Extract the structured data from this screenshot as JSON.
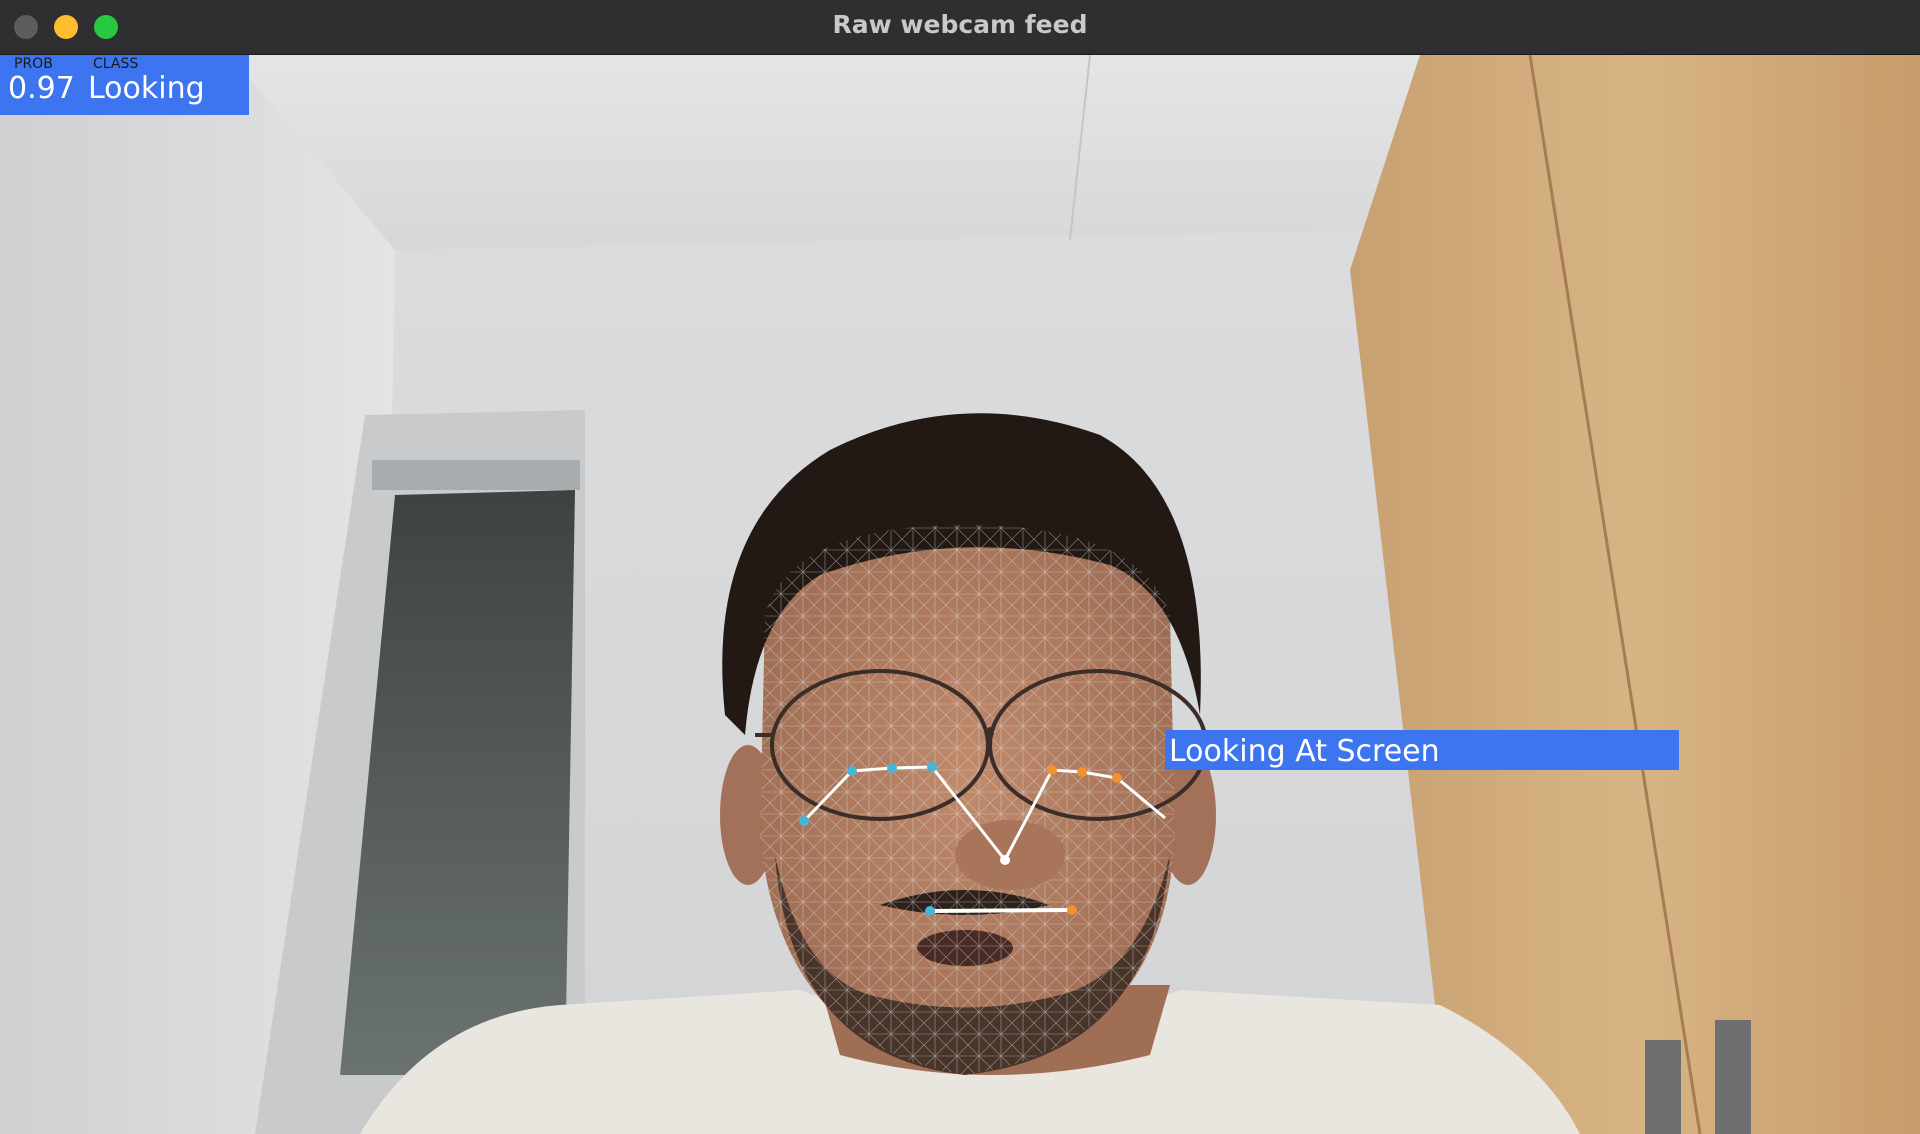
{
  "window": {
    "title": "Raw webcam feed"
  },
  "hud": {
    "prob_header": "PROB",
    "class_header": "CLASS",
    "prob_value": "0.97",
    "class_value": "Looking",
    "box_color": "#3d74f0"
  },
  "face_label": {
    "text": "Looking At Screen",
    "box_color": "#3d74f0"
  },
  "landmark_colors": {
    "left_eye": "#46b6d6",
    "right_eye": "#f0922e",
    "mesh": "#d9d9d9",
    "connector": "#ffffff"
  }
}
